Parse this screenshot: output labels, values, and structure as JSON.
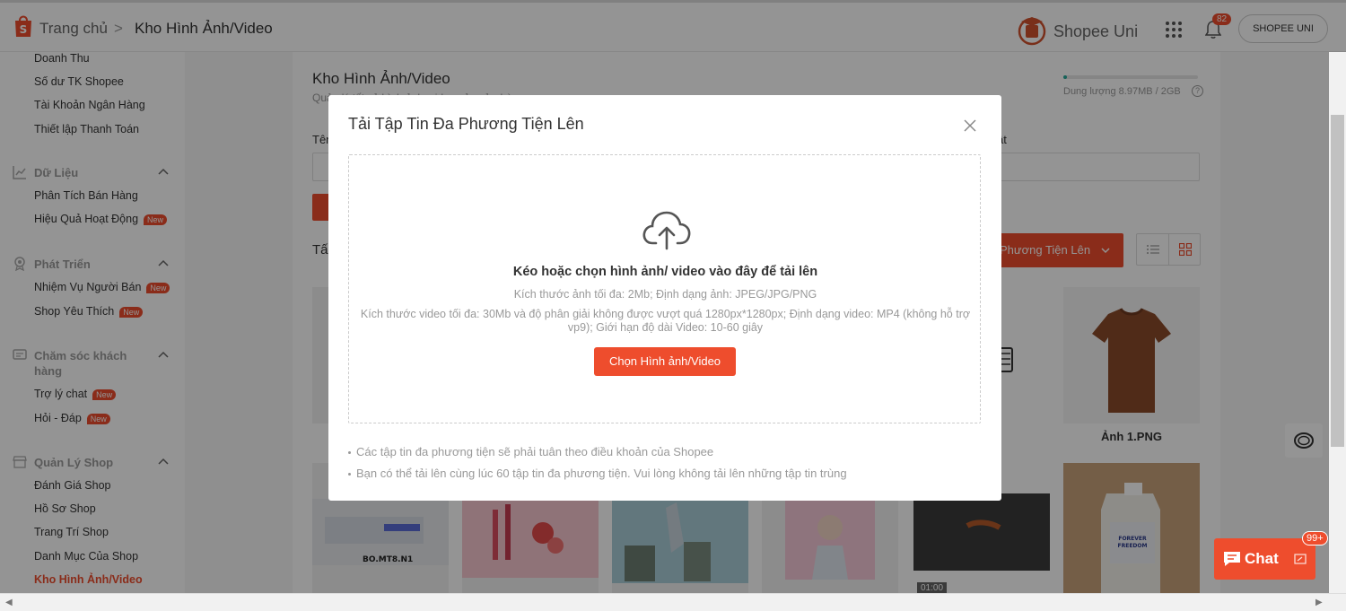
{
  "header": {
    "breadcrumb_home": "Trang chủ",
    "breadcrumb_separator": ">",
    "breadcrumb_current": "Kho Hình Ảnh/Video",
    "brand_name": "Shopee Uni",
    "notification_count": "82",
    "shop_button": "SHOPEE UNI"
  },
  "sidebar": {
    "finance_items": [
      "Doanh Thu",
      "Số dư TK Shopee",
      "Tài Khoản Ngân Hàng",
      "Thiết lập Thanh Toán"
    ],
    "data_section": {
      "title": "Dữ Liệu",
      "items": [
        "Phân Tích Bán Hàng",
        "Hiệu Quả Hoạt Động"
      ]
    },
    "growth_section": {
      "title": "Phát Triển",
      "items": [
        "Nhiệm Vụ Người Bán",
        "Shop Yêu Thích"
      ]
    },
    "care_section": {
      "title": "Chăm sóc khách hàng",
      "items": [
        "Trợ lý chat",
        "Hỏi - Đáp"
      ]
    },
    "shop_section": {
      "title": "Quản Lý Shop",
      "items": [
        "Đánh Giá Shop",
        "Hồ Sơ Shop",
        "Trang Trí Shop",
        "Danh Mục Của Shop",
        "Kho Hình Ảnh/Video"
      ]
    },
    "new_label": "New"
  },
  "main": {
    "title": "Kho Hình Ảnh/Video",
    "subtitle": "Quản lý tất cả hình ảnh, video của cửa hàng",
    "capacity_text": "Dung lượng 8.97MB / 2GB",
    "capacity_fraction": 0.0044,
    "help_glyph": "?",
    "filter_label_left": "Tên",
    "filter_label_right": "ật",
    "all_label": "Tấ",
    "upload_button": "Phương Tiện Lên",
    "tile_captions": [
      "G",
      "Ảnh 1.PNG"
    ],
    "video_duration": "01:00"
  },
  "modal": {
    "title": "Tải Tập Tin Đa Phương Tiện Lên",
    "drop_title": "Kéo hoặc chọn hình ảnh/ video vào đây để tải lên",
    "image_rule": "Kích thước ảnh tối đa: 2Mb; Định dạng ảnh: JPEG/JPG/PNG",
    "video_rule": "Kích thước video tối đa: 30Mb và độ phân giải không được vượt quá 1280px*1280px; Định dạng video: MP4 (không hỗ trợ vp9); Giới hạn độ dài Video: 10-60 giây",
    "select_button": "Chọn Hình ảnh/Video",
    "notes": [
      "Các tập tin đa phương tiện sẽ phải tuân theo điều khoản của Shopee",
      "Bạn có thể tải lên cùng lúc 60 tập tin đa phương tiện. Vui lòng không tải lên những tập tin trùng"
    ]
  },
  "chat": {
    "label": "Chat",
    "badge": "99+"
  },
  "colors": {
    "accent": "#ee4d2d",
    "capacity": "#26aa99"
  }
}
